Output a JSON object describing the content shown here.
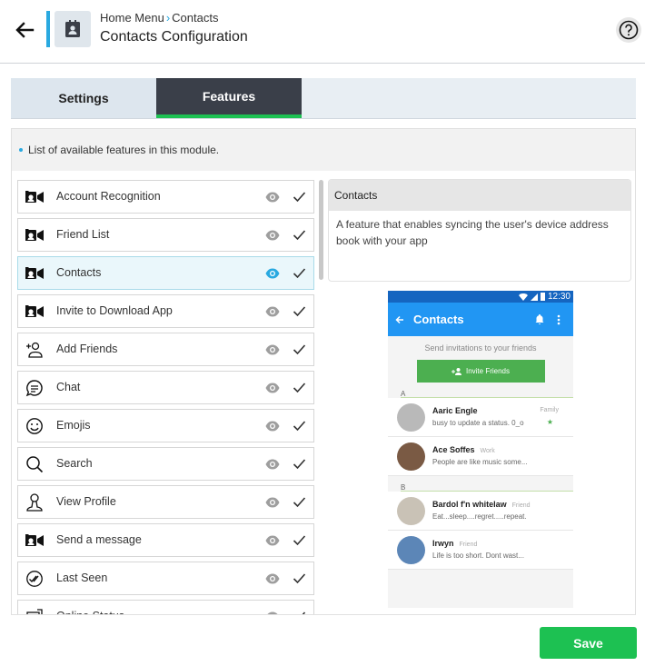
{
  "header": {
    "breadcrumb_root": "Home Menu",
    "breadcrumb_current": "Contacts",
    "title": "Contacts Configuration"
  },
  "tabs": [
    {
      "label": "Settings",
      "active": false
    },
    {
      "label": "Features",
      "active": true
    }
  ],
  "info": "List of available features in this module.",
  "features": [
    {
      "label": "Account Recognition",
      "icon": "video-camera-icon",
      "active": false
    },
    {
      "label": "Friend List",
      "icon": "video-camera-icon",
      "active": false
    },
    {
      "label": "Contacts",
      "icon": "video-camera-icon",
      "active": true
    },
    {
      "label": "Invite to Download App",
      "icon": "video-camera-icon",
      "active": false
    },
    {
      "label": "Add Friends",
      "icon": "add-person-icon",
      "active": false
    },
    {
      "label": "Chat",
      "icon": "chat-bubble-icon",
      "active": false
    },
    {
      "label": "Emojis",
      "icon": "smiley-icon",
      "active": false
    },
    {
      "label": "Search",
      "icon": "search-icon",
      "active": false
    },
    {
      "label": "View Profile",
      "icon": "profile-icon",
      "active": false
    },
    {
      "label": "Send a message",
      "icon": "video-camera-icon",
      "active": false
    },
    {
      "label": "Last Seen",
      "icon": "double-check-icon",
      "active": false
    },
    {
      "label": "Online Status",
      "icon": "status-icon",
      "active": false
    }
  ],
  "detail": {
    "title": "Contacts",
    "description": "A feature that enables syncing the user's device address book with your app"
  },
  "preview": {
    "time": "12:30",
    "app_title": "Contacts",
    "invite_text": "Send invitations to your friends",
    "invite_button": "Invite Friends",
    "section_a": "A",
    "section_b": "B",
    "contacts": [
      {
        "name": "Aaric Engle",
        "tag": "",
        "status": "busy to update a status. 0_o",
        "side": "Family"
      },
      {
        "name": "Ace Soffes",
        "tag": "Work",
        "status": "People are like music some...",
        "side": ""
      },
      {
        "name": "Bardol f'n whitelaw",
        "tag": "Friend",
        "status": "Eat...sleep....regret.....repeat.",
        "side": ""
      },
      {
        "name": "Irwyn",
        "tag": "Friend",
        "status": "Life is too short. Dont wast...",
        "side": ""
      }
    ]
  },
  "save_label": "Save",
  "colors": {
    "accent": "#29a9e0",
    "green": "#1dc152",
    "tab_dark": "#3a3f49",
    "phone_blue": "#2196f3"
  }
}
